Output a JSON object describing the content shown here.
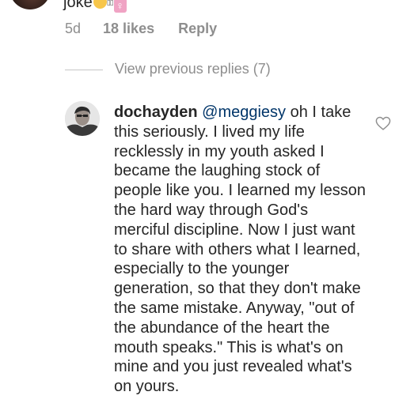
{
  "previous_comment": {
    "text": "joke",
    "emoji_box_glyph": "▯▯",
    "emoji_female_glyph": "♀",
    "age": "5d",
    "likes": "18 likes",
    "reply_label": "Reply"
  },
  "view_previous_replies": "View previous replies (7)",
  "reply": {
    "username": "dochayden",
    "mention": "@meggiesy",
    "text": "oh I take this seriously. I lived my life recklessly in my youth asked I became the laughing stock of people like you. I learned my lesson the hard way through God's merciful discipline. Now I just want to share with others what I learned, especially to the younger generation, so that they don't make the same mistake. Anyway, \"out of the abundance of the heart the mouth speaks.\" This is what's on mine and you just revealed what's on yours."
  },
  "icons": {
    "like": "heart-outline-icon"
  },
  "colors": {
    "mention": "#003569",
    "meta": "#8e8e8e",
    "text": "#262626"
  }
}
